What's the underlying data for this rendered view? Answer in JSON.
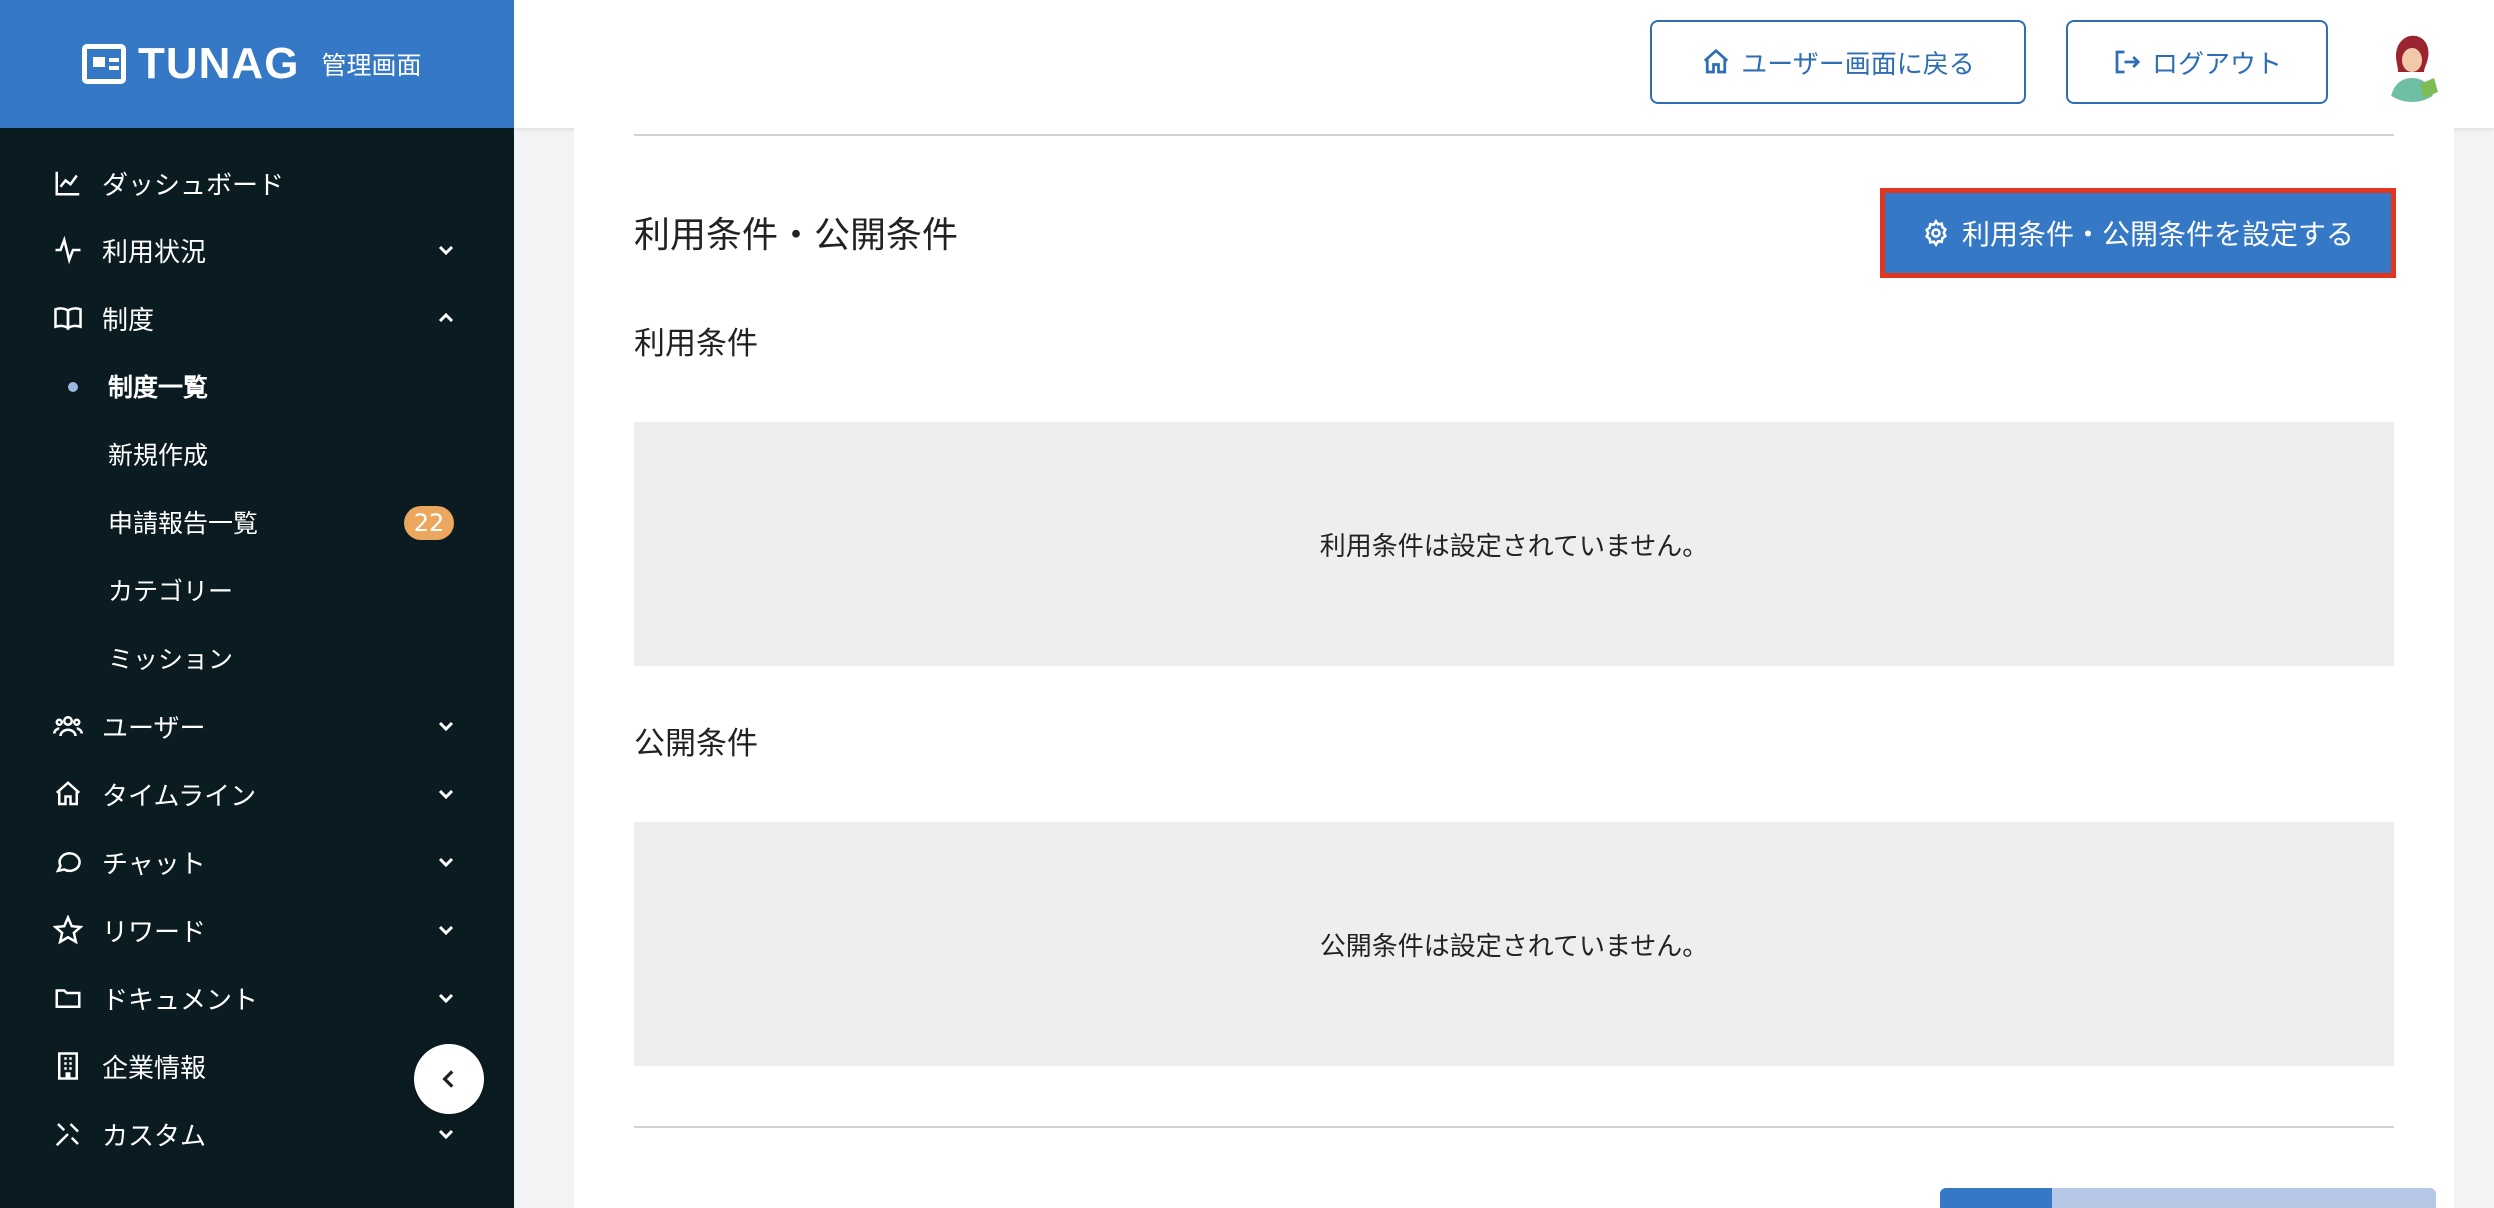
{
  "brand": {
    "logo_text": "TUNAG",
    "subtitle": "管理画面"
  },
  "sidebar": {
    "items": [
      {
        "label": "ダッシュボード",
        "icon": "chart-line-icon",
        "expandable": false
      },
      {
        "label": "利用状況",
        "icon": "activity-icon",
        "expandable": true,
        "expanded": false
      },
      {
        "label": "制度",
        "icon": "book-icon",
        "expandable": true,
        "expanded": true
      },
      {
        "label": "ユーザー",
        "icon": "users-icon",
        "expandable": true,
        "expanded": false
      },
      {
        "label": "タイムライン",
        "icon": "home-icon",
        "expandable": true,
        "expanded": false
      },
      {
        "label": "チャット",
        "icon": "chat-bubble-icon",
        "expandable": true,
        "expanded": false
      },
      {
        "label": "リワード",
        "icon": "star-icon",
        "expandable": true,
        "expanded": false
      },
      {
        "label": "ドキュメント",
        "icon": "folder-icon",
        "expandable": true,
        "expanded": false
      },
      {
        "label": "企業情報",
        "icon": "building-icon",
        "expandable": false
      },
      {
        "label": "カスタム",
        "icon": "tools-icon",
        "expandable": true,
        "expanded": false
      }
    ],
    "sub_items": [
      {
        "label": "制度一覧",
        "active": true
      },
      {
        "label": "新規作成",
        "active": false
      },
      {
        "label": "申請報告一覧",
        "active": false,
        "badge": "22"
      },
      {
        "label": "カテゴリー",
        "active": false
      },
      {
        "label": "ミッション",
        "active": false
      }
    ]
  },
  "header": {
    "user_screen_label": "ユーザー画面に戻る",
    "logout_label": "ログアウト"
  },
  "main": {
    "section_title": "利用条件・公開条件",
    "settings_button_label": "利用条件・公開条件を設定する",
    "usage_conditions": {
      "title": "利用条件",
      "empty_message": "利用条件は設定されていません。"
    },
    "publish_conditions": {
      "title": "公開条件",
      "empty_message": "公開条件は設定されていません。"
    }
  },
  "colors": {
    "brand_blue": "#3478c6",
    "sidebar_bg": "#0a1c22",
    "highlight_border": "#e1351f",
    "badge_orange": "#eba75d",
    "empty_box_bg": "#edeef0"
  }
}
